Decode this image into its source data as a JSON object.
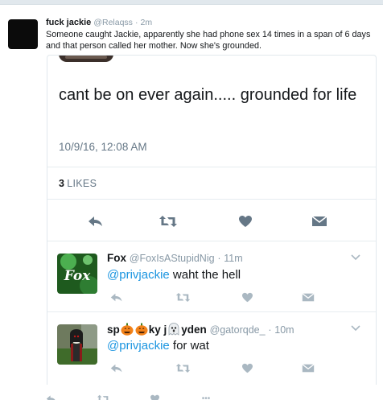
{
  "tweet": {
    "author_name": "fuck jackie",
    "author_handle": "@Relaqss",
    "separator": "·",
    "age": "2m",
    "text": "Someone caught Jackie, apparently she had phone sex 14 times in a span of 6 days and that person called her mother. Now she's grounded."
  },
  "quoted": {
    "text": "cant be on ever again..... grounded for life",
    "timestamp": "10/9/16, 12:08 AM",
    "likes_count": "3",
    "likes_label": "LIKES",
    "actions": [
      "reply-icon",
      "retweet-icon",
      "like-heart-icon",
      "direct-message-icon"
    ]
  },
  "replies": [
    {
      "name": "Fox",
      "handle": "@FoxIsAStupidNig",
      "separator": "·",
      "age": "11m",
      "mention": "@privjackie",
      "text": " waht the hell",
      "avatar_label": "Fox"
    },
    {
      "name_parts": [
        "sp",
        "ky j",
        "yden"
      ],
      "handle": "@gatorqde_",
      "separator": "·",
      "age": "10m",
      "mention": "@privjackie",
      "text": " for wat"
    }
  ],
  "bottom": {
    "more_label": "•••"
  },
  "colors": {
    "link_blue": "#1b95e0",
    "icon_gray": "#657786",
    "icon_light": "#aab8c2",
    "border": "#e1e8ed"
  }
}
